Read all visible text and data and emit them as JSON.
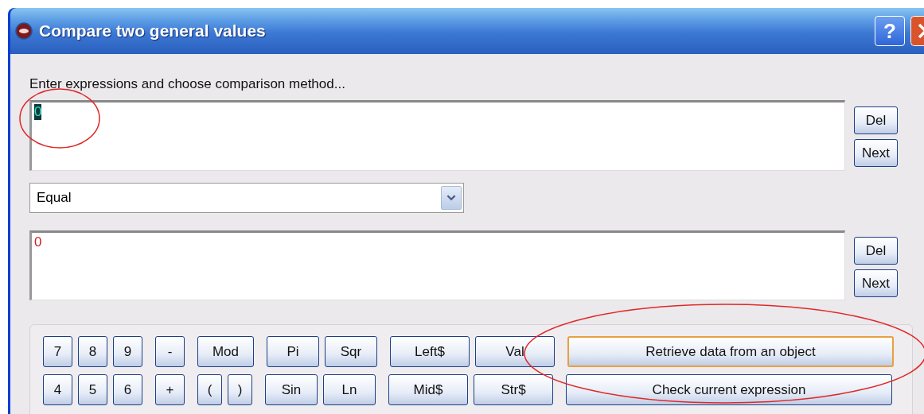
{
  "window": {
    "title": "Compare two general values",
    "buttons": [
      "?"
    ]
  },
  "instruction": "Enter expressions and choose comparison method...",
  "expressions": [
    {
      "value": "0",
      "selected": true,
      "buttons": [
        "Del",
        "Next"
      ]
    },
    {
      "value": "0",
      "selected": false,
      "buttons": [
        "Del",
        "Next"
      ]
    }
  ],
  "method": {
    "value": "Equal"
  },
  "keypad": {
    "rows": [
      {
        "groups": [
          [
            {
              "label": "7",
              "kind": "digit"
            },
            {
              "label": "8",
              "kind": "digit"
            },
            {
              "label": "9",
              "kind": "digit"
            }
          ],
          [
            {
              "label": "-",
              "kind": "digit"
            }
          ],
          [
            {
              "label": "Mod",
              "kind": "wide"
            }
          ],
          [
            {
              "label": "Pi",
              "kind": "func"
            },
            {
              "label": "Sqr",
              "kind": "func"
            }
          ],
          [
            {
              "label": "Left$",
              "kind": "string"
            },
            {
              "label": "Val",
              "kind": "string"
            }
          ],
          [
            {
              "label": "Retrieve data from an object",
              "kind": "action",
              "focused": true
            }
          ]
        ]
      },
      {
        "groups": [
          [
            {
              "label": "4",
              "kind": "digit"
            },
            {
              "label": "5",
              "kind": "digit"
            },
            {
              "label": "6",
              "kind": "digit"
            }
          ],
          [
            {
              "label": "+",
              "kind": "digit"
            }
          ],
          [
            {
              "label": "(",
              "kind": "paren"
            },
            {
              "label": ")",
              "kind": "paren"
            }
          ],
          [
            {
              "label": "Sin",
              "kind": "func"
            },
            {
              "label": "Ln",
              "kind": "func"
            }
          ],
          [
            {
              "label": "Mid$",
              "kind": "string"
            },
            {
              "label": "Str$",
              "kind": "string"
            }
          ],
          [
            {
              "label": "Check current expression",
              "kind": "action",
              "focused": false
            }
          ]
        ]
      }
    ]
  }
}
